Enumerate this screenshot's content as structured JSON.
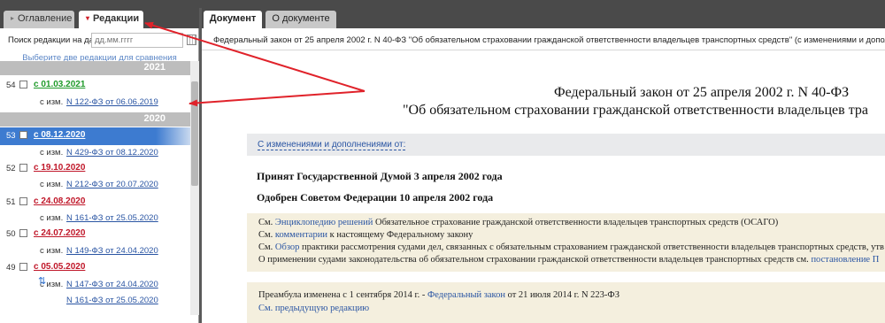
{
  "left_tabs": [
    {
      "label": "Оглавление",
      "marker": "▸"
    },
    {
      "label": "Редакции",
      "marker": "▾"
    }
  ],
  "search": {
    "label": "Поиск редакции на дату",
    "placeholder": "дд.мм.гггг"
  },
  "hint": "Выберите две редакции для сравнения",
  "years": [
    "2021",
    "2020"
  ],
  "editions": [
    {
      "num": "54",
      "date": "с 01.03.2021",
      "changes": [
        {
          "prefix": "с изм.",
          "link": "N 122-ФЗ от 06.06.2019"
        }
      ]
    },
    {
      "num": "53",
      "date": "с 08.12.2020",
      "changes": [
        {
          "prefix": "с изм.",
          "link": "N 429-ФЗ от 08.12.2020"
        }
      ]
    },
    {
      "num": "52",
      "date": "с 19.10.2020",
      "changes": [
        {
          "prefix": "с изм.",
          "link": "N 212-ФЗ от 20.07.2020"
        }
      ]
    },
    {
      "num": "51",
      "date": "с 24.08.2020",
      "changes": [
        {
          "prefix": "с изм.",
          "link": "N 161-ФЗ от 25.05.2020"
        }
      ]
    },
    {
      "num": "50",
      "date": "с 24.07.2020",
      "changes": [
        {
          "prefix": "с изм.",
          "link": "N 149-ФЗ от 24.04.2020"
        }
      ]
    },
    {
      "num": "49",
      "date": "с 05.05.2020",
      "changes": [
        {
          "prefix": "с изм.",
          "link": "N 147-ФЗ от 24.04.2020"
        },
        {
          "prefix": "",
          "link": "N 161-ФЗ от 25.05.2020"
        }
      ]
    }
  ],
  "right_tabs": [
    {
      "label": "Документ"
    },
    {
      "label": "О документе"
    }
  ],
  "doc_header": "Федеральный закон от 25 апреля 2002 г. N 40-ФЗ \"Об обязательном страховании гражданской ответственности владельцев транспортных средств\" (с изменениями и дополнениями)",
  "law_title_line1": "Федеральный закон от 25 апреля 2002 г. N 40-ФЗ",
  "law_title_line2": "\"Об обязательном страховании гражданской ответственности владельцев тра",
  "amendments_link": "С изменениями и дополнениями от:",
  "accepted": "Принят Государственной Думой 3 апреля 2002 года",
  "approved": "Одобрен Советом Федерации 10 апреля 2002 года",
  "notes": [
    {
      "pre": "См. ",
      "link": "Энциклопедию решений",
      "post": " Обязательное страхование гражданской ответственности владельцев транспортных средств (ОСАГО)"
    },
    {
      "pre": "См. ",
      "link": "комментарии",
      "post": " к настоящему Федеральному закону"
    },
    {
      "pre": "См. ",
      "link": "Обзор",
      "post": " практики рассмотрения судами дел, связанных с обязательным страхованием гражданской ответственности владельцев транспортных средств, утв"
    },
    {
      "pre": "О применении судами законодательства об обязательном страховании гражданской ответственности владельцев транспортных средств см. ",
      "link": "постановление П",
      "post": ""
    }
  ],
  "preamble_note": {
    "pre": "Преамбула изменена с 1 сентября 2014 г. - ",
    "link": "Федеральный закон",
    "post": " от 21 июля 2014 г. N 223-ФЗ",
    "prev_link": "См. предыдущую редакцию"
  },
  "colors": {
    "selected_row": "#3d7bd0",
    "link": "#2a55a3",
    "green_date": "#1f9a2a",
    "red_date": "#c0182a",
    "annotation_arrow": "#e0222a"
  }
}
